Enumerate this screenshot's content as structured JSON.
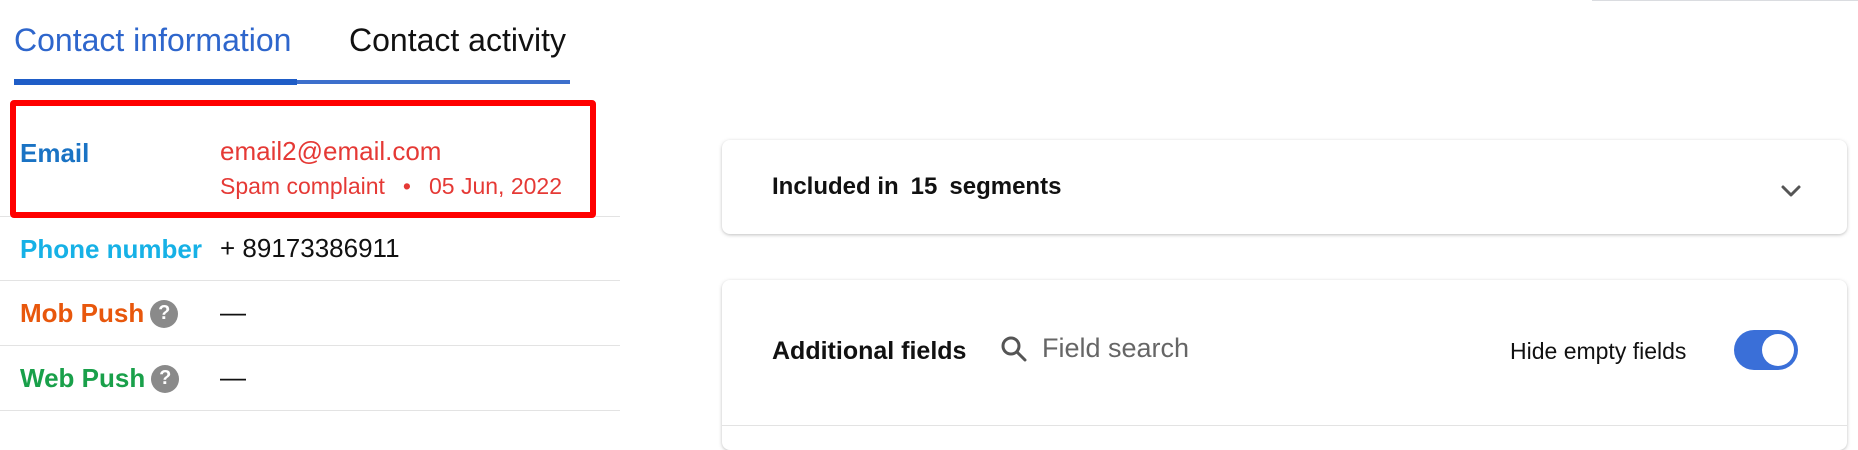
{
  "tabs": {
    "contact_information": "Contact information",
    "contact_activity": "Contact activity",
    "active": "contact_information"
  },
  "fields": {
    "email": {
      "label": "Email",
      "value": "email2@email.com",
      "status": "Spam complaint",
      "separator": "•",
      "date": "05 Jun, 2022"
    },
    "phone": {
      "label": "Phone number",
      "value": "+ 89173386911"
    },
    "mob_push": {
      "label": "Mob Push",
      "value": "—",
      "help_glyph": "?"
    },
    "web_push": {
      "label": "Web Push",
      "value": "—",
      "help_glyph": "?"
    }
  },
  "segments_panel": {
    "prefix": "Included in",
    "count": "15",
    "suffix": "segments",
    "icon": "chevron-down-icon"
  },
  "additional_fields": {
    "title": "Additional fields",
    "search_placeholder": "Field search",
    "search_icon": "search-icon",
    "hide_empty_label": "Hide empty fields",
    "hide_empty_enabled": true
  },
  "colors": {
    "accent_blue": "#2e66cc",
    "email_label": "#1a73c4",
    "phone_label": "#16b1e6",
    "mob_push_label": "#e8570c",
    "web_push_label": "#19a04a",
    "error_red": "#e53935",
    "highlight_red": "#ff0000",
    "toggle_on": "#3a6fd8"
  }
}
